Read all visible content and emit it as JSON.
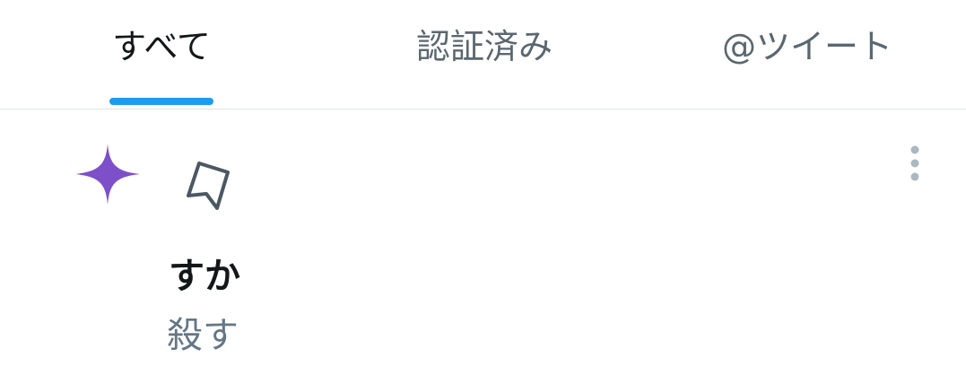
{
  "tabs": [
    {
      "label": "すべて",
      "active": true
    },
    {
      "label": "認証済み",
      "active": false
    },
    {
      "label": "@ツイート",
      "active": false
    }
  ],
  "colors": {
    "accent": "#1d9bf0",
    "sparkle": "#7d4fc9",
    "text_primary": "#14171a",
    "text_secondary": "#657786"
  },
  "icons": {
    "sparkle": "sparkle-icon",
    "bookmark": "bookmark-icon",
    "more": "more-vertical-icon"
  },
  "notification": {
    "title": "すか",
    "subtitle": "殺す"
  }
}
